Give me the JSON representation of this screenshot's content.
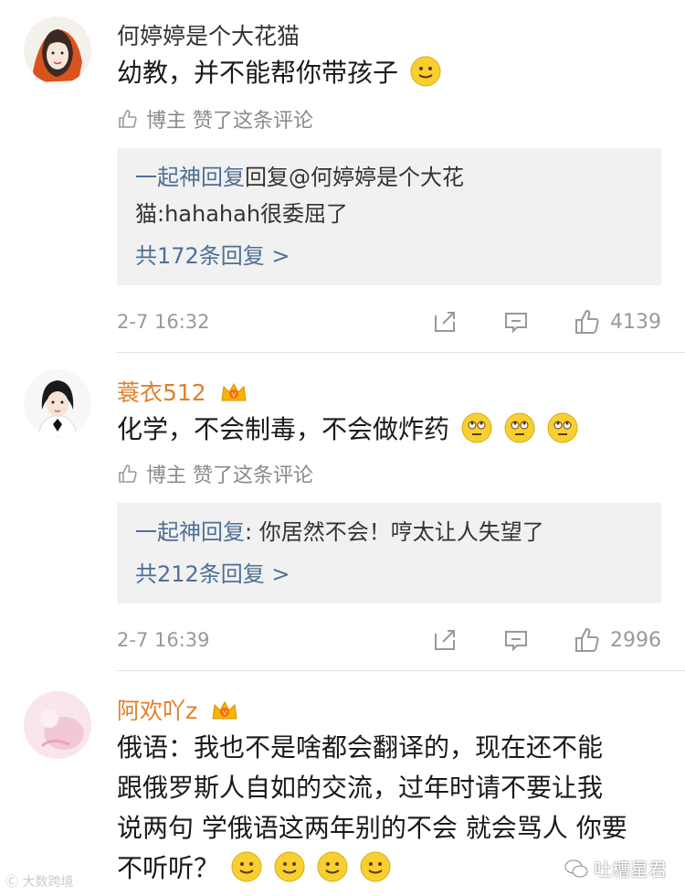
{
  "comments": [
    {
      "username": "何婷婷是个大花猫",
      "text": "幼教，并不能帮你带孩子",
      "liked_by_author": "博主 赞了这条评论",
      "reply_user": "一起神回复",
      "reply_text_1": "回复@何婷婷是个大花",
      "reply_text_2": "猫:hahahah很委屈了",
      "reply_more": "共172条回复 >",
      "time": "2-7 16:32",
      "likes": "4139"
    },
    {
      "username": "蓑衣512",
      "text": "化学，不会制毒，不会做炸药",
      "liked_by_author": "博主 赞了这条评论",
      "reply_user": "一起神回复",
      "reply_text_1": ": 你居然不会！哼太让人失望了",
      "reply_more": "共212条回复 >",
      "time": "2-7 16:39",
      "likes": "2996"
    },
    {
      "username": "阿欢吖z",
      "text_lines": [
        "俄语：我也不是啥都会翻译的，现在还不能",
        "跟俄罗斯人自如的交流，过年时请不要让我",
        "说两句 学俄语这两年别的不会 就会骂人 你要",
        "不听听？"
      ]
    }
  ],
  "watermark_left": "大数跨境",
  "watermark_right": "吐槽星君",
  "colors": {
    "username_orange": "#e0802a",
    "link_blue": "#4f6f96",
    "gray": "#999999"
  }
}
